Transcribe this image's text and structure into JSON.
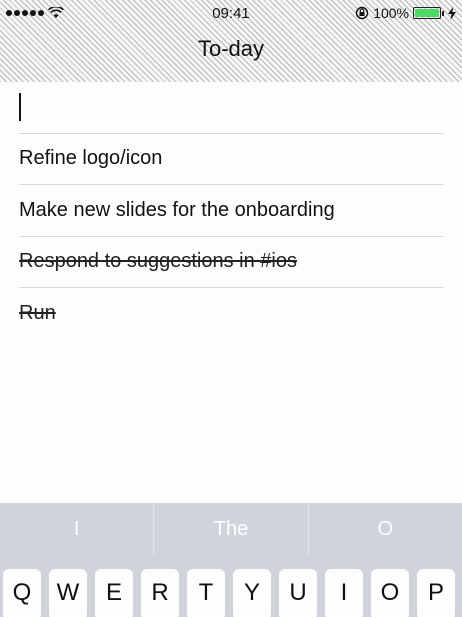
{
  "status_bar": {
    "time": "09:41",
    "battery_percent": "100%",
    "battery_level": 1.0,
    "battery_color": "#4cd964",
    "icons": [
      "signal-dots-icon",
      "wifi-icon",
      "rotation-lock-icon",
      "battery-icon",
      "charging-bolt-icon"
    ]
  },
  "header": {
    "title": "To-day"
  },
  "todos": {
    "input_value": "",
    "items": [
      {
        "label": "Refine logo/icon",
        "done": false
      },
      {
        "label": "Make new slides for the onboarding",
        "done": false
      },
      {
        "label": "Respond to suggestions in #ios",
        "done": true
      },
      {
        "label": "Run",
        "done": true
      }
    ]
  },
  "predictive": {
    "suggestions": [
      "I",
      "The",
      "O"
    ]
  },
  "keyboard": {
    "row1": [
      "Q",
      "W",
      "E",
      "R",
      "T",
      "Y",
      "U",
      "I",
      "O",
      "P"
    ]
  }
}
